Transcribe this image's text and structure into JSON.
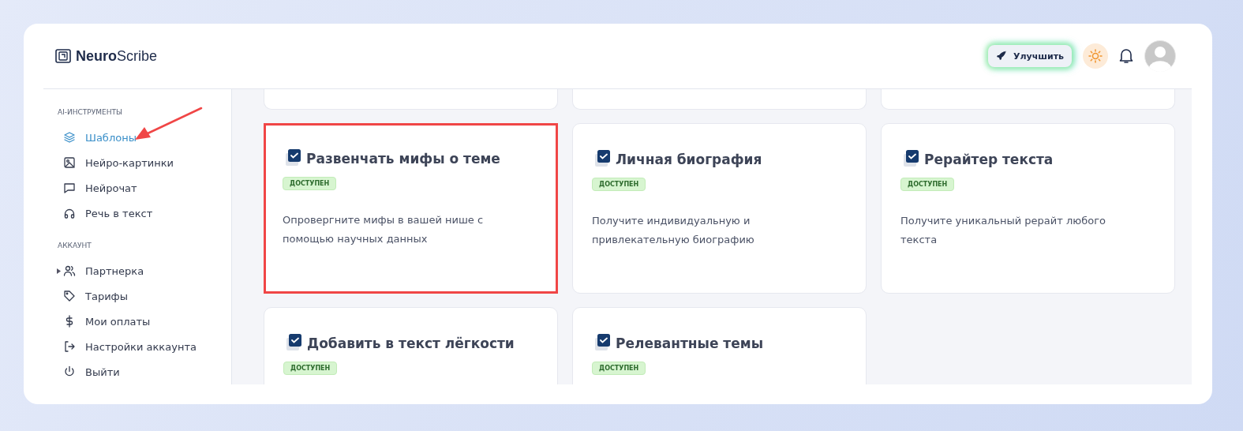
{
  "header": {
    "logo": {
      "bold": "Neuro",
      "light": "Scribe"
    },
    "upgrade_button": "Улучшить"
  },
  "sidebar": {
    "sections": [
      {
        "title": "AI-ИНСТРУМЕНТЫ",
        "items": [
          {
            "label": "Шаблоны",
            "selected": true,
            "pointed": true
          },
          {
            "label": "Нейро-картинки",
            "selected": false,
            "pointed": false
          },
          {
            "label": "Нейрочат",
            "selected": false,
            "pointed": false
          },
          {
            "label": "Речь в текст",
            "selected": false,
            "pointed": false
          }
        ]
      },
      {
        "title": "АККАУНТ",
        "items": [
          {
            "label": "Партнерка",
            "selected": false,
            "pointed": false,
            "expanded": false
          },
          {
            "label": "Тарифы",
            "selected": false,
            "pointed": false
          },
          {
            "label": "Мои оплаты",
            "selected": false,
            "pointed": false
          },
          {
            "label": "Настройки аккаунта",
            "selected": false,
            "pointed": false
          },
          {
            "label": "Выйти",
            "selected": false,
            "pointed": false
          }
        ]
      }
    ]
  },
  "cards": [
    {
      "title": "Развенчать мифы о теме",
      "badge": "ДОСТУПЕН",
      "description": "Опровергните мифы в вашей нише с помощью научных данных",
      "highlighted": true
    },
    {
      "title": "Личная биография",
      "badge": "ДОСТУПЕН",
      "description": "Получите индивидуальную и привлекательную биографию",
      "highlighted": false
    },
    {
      "title": "Рерайтер текста",
      "badge": "ДОСТУПЕН",
      "description": "Получите уникальный рерайт любого текста",
      "highlighted": false
    },
    {
      "title": "Добавить в текст лёгкости",
      "badge": "ДОСТУПЕН",
      "highlighted": false
    },
    {
      "title": "Релевантные темы",
      "badge": "ДОСТУПЕН",
      "highlighted": false
    }
  ]
}
